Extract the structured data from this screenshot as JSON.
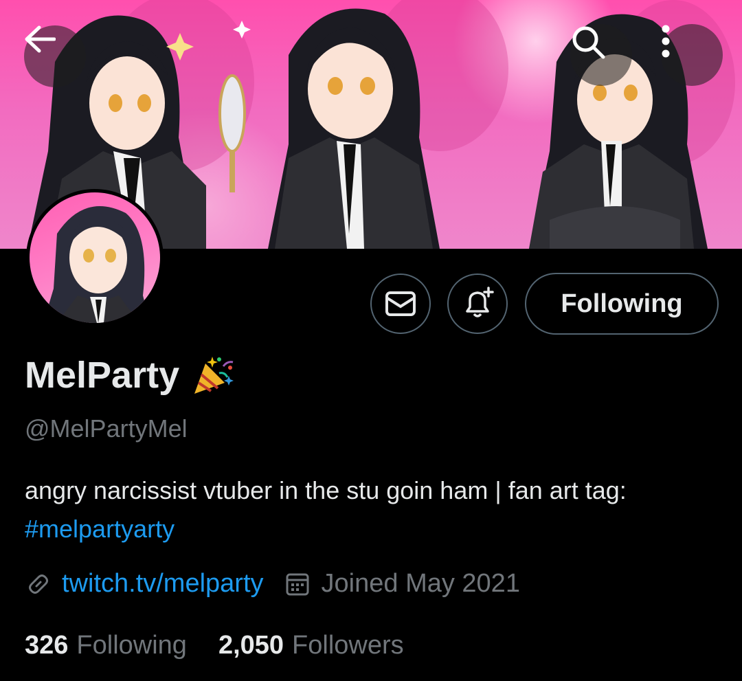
{
  "header": {
    "back_icon": "arrow-left-icon",
    "search_icon": "search-icon",
    "more_icon": "more-vertical-icon"
  },
  "banner": {
    "description_icon": "banner-artwork",
    "bg_color": "#f26cc0"
  },
  "profile": {
    "display_name": "MelParty",
    "name_emoji": "🎉",
    "handle": "@MelPartyMel",
    "bio_text": "angry narcissist vtuber in the stu goin ham  | fan art tag: ",
    "bio_hashtag": "#melpartyarty",
    "website": "twitch.tv/melparty",
    "joined": "Joined May 2021",
    "following_count": "326",
    "following_label": "Following",
    "followers_count": "2,050",
    "followers_label": "Followers"
  },
  "actions": {
    "message_icon": "envelope-icon",
    "notify_icon": "bell-plus-icon",
    "following_button": "Following"
  },
  "colors": {
    "link": "#1d9bf0",
    "muted": "#71767b",
    "text": "#e7e9ea",
    "border": "#536471"
  }
}
